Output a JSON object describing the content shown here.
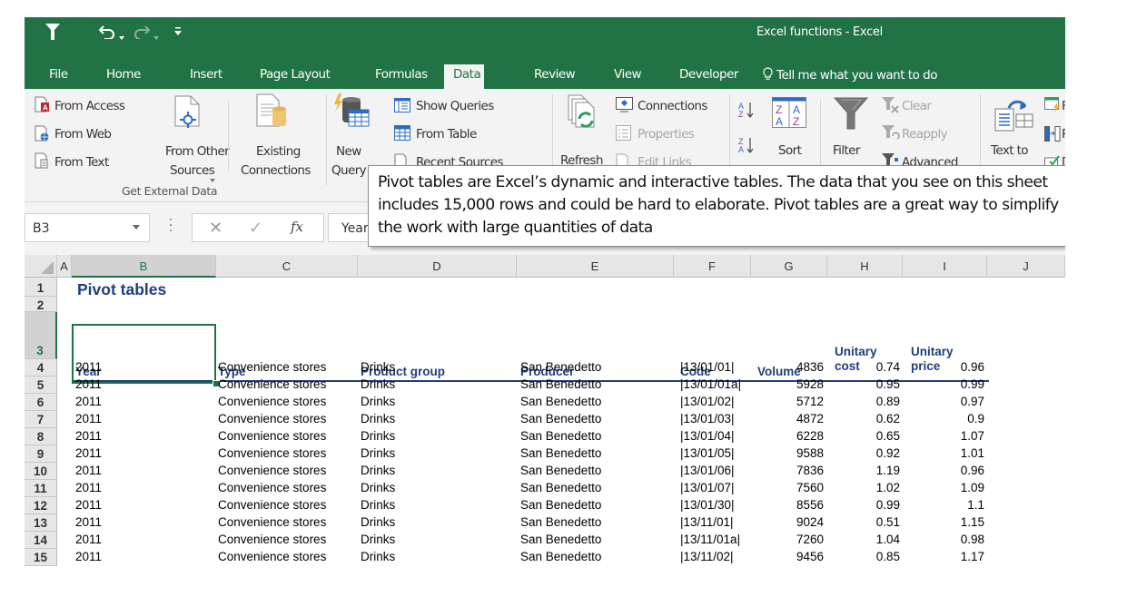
{
  "window": {
    "title": "Excel functions - Excel",
    "accent_color": "#217346"
  },
  "quick_access": {
    "icons": [
      "filter-icon",
      "undo-icon",
      "redo-icon",
      "customize-qat-icon"
    ]
  },
  "tabs": [
    {
      "label": "File",
      "active": false
    },
    {
      "label": "Home",
      "active": false
    },
    {
      "label": "Insert",
      "active": false
    },
    {
      "label": "Page Layout",
      "active": false
    },
    {
      "label": "Formulas",
      "active": false
    },
    {
      "label": "Data",
      "active": true
    },
    {
      "label": "Review",
      "active": false
    },
    {
      "label": "View",
      "active": false
    },
    {
      "label": "Developer",
      "active": false
    }
  ],
  "tell_me": "Tell me what you want to do",
  "ribbon": {
    "get_external_data": {
      "label": "Get External Data",
      "from_access": "From Access",
      "from_web": "From Web",
      "from_text": "From Text",
      "from_other_sources_1": "From Other",
      "from_other_sources_2": "Sources",
      "existing_connections_1": "Existing",
      "existing_connections_2": "Connections"
    },
    "get_transform": {
      "new_query_1": "New",
      "new_query_2": "Query",
      "show_queries": "Show Queries",
      "from_table": "From Table",
      "recent_sources": "Recent Sources"
    },
    "connections": {
      "refresh": "Refresh",
      "connections": "Connections",
      "properties": "Properties",
      "edit_links": "Edit Links"
    },
    "sort_filter": {
      "sort": "Sort",
      "filter": "Filter",
      "clear": "Clear",
      "reapply": "Reapply",
      "advanced": "Advanced"
    },
    "data_tools": {
      "text_to": "Text to",
      "flash_fill": "Fl",
      "remove_duplicates": "Re",
      "data_validation": "D"
    }
  },
  "formula_bar": {
    "name_box": "B3",
    "formula": "Year"
  },
  "callout": {
    "text": "Pivot tables are Excel’s dynamic and interactive tables. The data that you see on this sheet includes 15,000 rows and could be hard to elaborate. Pivot tables are a great way to simplify the work with large quantities of data"
  },
  "sheet": {
    "columns": [
      "A",
      "B",
      "C",
      "D",
      "E",
      "F",
      "G",
      "H",
      "I",
      "J"
    ],
    "selected_column": "B",
    "rows": [
      "1",
      "2",
      "3",
      "4",
      "5",
      "6",
      "7",
      "8",
      "9",
      "10",
      "11",
      "12",
      "13",
      "14",
      "15"
    ],
    "selected_row": "3",
    "title": "Pivot tables",
    "headers": {
      "year": "Year",
      "type": "Type",
      "product_group": "Product group",
      "producer": "Producer",
      "code": "Code",
      "volume": "Volume",
      "unitary_cost_1": "Unitary",
      "unitary_cost_2": "cost",
      "unitary_price_1": "Unitary",
      "unitary_price_2": "price"
    },
    "data": [
      {
        "year": "2011",
        "type": "Convenience stores",
        "group": "Drinks",
        "producer": "San Benedetto",
        "code": "|13/01/01|",
        "volume": "4836",
        "cost": "0.74",
        "price": "0.96"
      },
      {
        "year": "2011",
        "type": "Convenience stores",
        "group": "Drinks",
        "producer": "San Benedetto",
        "code": "|13/01/01a|",
        "volume": "5928",
        "cost": "0.95",
        "price": "0.99"
      },
      {
        "year": "2011",
        "type": "Convenience stores",
        "group": "Drinks",
        "producer": "San Benedetto",
        "code": "|13/01/02|",
        "volume": "5712",
        "cost": "0.89",
        "price": "0.97"
      },
      {
        "year": "2011",
        "type": "Convenience stores",
        "group": "Drinks",
        "producer": "San Benedetto",
        "code": "|13/01/03|",
        "volume": "4872",
        "cost": "0.62",
        "price": "0.9"
      },
      {
        "year": "2011",
        "type": "Convenience stores",
        "group": "Drinks",
        "producer": "San Benedetto",
        "code": "|13/01/04|",
        "volume": "6228",
        "cost": "0.65",
        "price": "1.07"
      },
      {
        "year": "2011",
        "type": "Convenience stores",
        "group": "Drinks",
        "producer": "San Benedetto",
        "code": "|13/01/05|",
        "volume": "9588",
        "cost": "0.92",
        "price": "1.01"
      },
      {
        "year": "2011",
        "type": "Convenience stores",
        "group": "Drinks",
        "producer": "San Benedetto",
        "code": "|13/01/06|",
        "volume": "7836",
        "cost": "1.19",
        "price": "0.96"
      },
      {
        "year": "2011",
        "type": "Convenience stores",
        "group": "Drinks",
        "producer": "San Benedetto",
        "code": "|13/01/07|",
        "volume": "7560",
        "cost": "1.02",
        "price": "1.09"
      },
      {
        "year": "2011",
        "type": "Convenience stores",
        "group": "Drinks",
        "producer": "San Benedetto",
        "code": "|13/01/30|",
        "volume": "8556",
        "cost": "0.99",
        "price": "1.1"
      },
      {
        "year": "2011",
        "type": "Convenience stores",
        "group": "Drinks",
        "producer": "San Benedetto",
        "code": "|13/11/01|",
        "volume": "9024",
        "cost": "0.51",
        "price": "1.15"
      },
      {
        "year": "2011",
        "type": "Convenience stores",
        "group": "Drinks",
        "producer": "San Benedetto",
        "code": "|13/11/01a|",
        "volume": "7260",
        "cost": "1.04",
        "price": "0.98"
      },
      {
        "year": "2011",
        "type": "Convenience stores",
        "group": "Drinks",
        "producer": "San Benedetto",
        "code": "|13/11/02|",
        "volume": "9456",
        "cost": "0.85",
        "price": "1.17"
      }
    ]
  }
}
